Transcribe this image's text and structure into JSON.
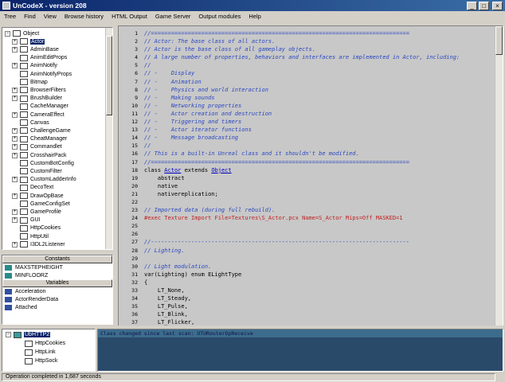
{
  "window": {
    "title": "UnCodeX - version 208",
    "min": "_",
    "max": "□",
    "close": "×"
  },
  "menu": [
    "Tree",
    "Find",
    "View",
    "Browse history",
    "HTML Output",
    "Game Server",
    "Output modules",
    "Help"
  ],
  "tree": {
    "root": "Object",
    "items": [
      {
        "label": "Actor",
        "exp": true,
        "selected": true
      },
      {
        "label": "AdminBase",
        "exp": true
      },
      {
        "label": "AnimEditProps",
        "exp": false
      },
      {
        "label": "AnimNotify",
        "exp": true
      },
      {
        "label": "AnimNotifyProps",
        "exp": false
      },
      {
        "label": "Bitmap",
        "exp": false
      },
      {
        "label": "BrowserFilters",
        "exp": true
      },
      {
        "label": "BrushBuilder",
        "exp": true
      },
      {
        "label": "CacheManager",
        "exp": false
      },
      {
        "label": "CameraEffect",
        "exp": true
      },
      {
        "label": "Canvas",
        "exp": false
      },
      {
        "label": "ChallengeGame",
        "exp": true
      },
      {
        "label": "CheatManager",
        "exp": true
      },
      {
        "label": "Commandlet",
        "exp": true
      },
      {
        "label": "CrosshairPack",
        "exp": true
      },
      {
        "label": "CustomBotConfig",
        "exp": false
      },
      {
        "label": "CustomFilter",
        "exp": false
      },
      {
        "label": "CustomLadderInfo",
        "exp": true
      },
      {
        "label": "DecoText",
        "exp": false
      },
      {
        "label": "DrawOpBase",
        "exp": true
      },
      {
        "label": "GameConfigSet",
        "exp": false
      },
      {
        "label": "GameProfile",
        "exp": true
      },
      {
        "label": "GUI",
        "exp": true
      },
      {
        "label": "HttpCookies",
        "exp": false
      },
      {
        "label": "HttpUtil",
        "exp": false
      },
      {
        "label": "I3DL2Listener",
        "exp": true
      }
    ]
  },
  "panel": {
    "constants_header": "Constants",
    "constants": [
      "MAXSTEPHEIGHT",
      "MINFLOORZ"
    ],
    "variables_header": "Variables",
    "variables": [
      "Acceleration",
      "ActorRenderData",
      "Attached"
    ]
  },
  "editor": {
    "lines": [
      {
        "n": "1",
        "parts": [
          {
            "t": "//=============================================================================",
            "c": "cm"
          }
        ]
      },
      {
        "n": "2",
        "parts": [
          {
            "t": "// Actor: The base class of all actors.",
            "c": "cm"
          }
        ]
      },
      {
        "n": "3",
        "parts": [
          {
            "t": "// Actor is the base class of all gameplay objects.",
            "c": "cm"
          }
        ]
      },
      {
        "n": "4",
        "parts": [
          {
            "t": "// A large number of properties, behaviors and interfaces are implemented in Actor, including:",
            "c": "cm"
          }
        ]
      },
      {
        "n": "5",
        "parts": [
          {
            "t": "//",
            "c": "cm"
          }
        ]
      },
      {
        "n": "6",
        "parts": [
          {
            "t": "// -    Display",
            "c": "cm"
          }
        ]
      },
      {
        "n": "7",
        "parts": [
          {
            "t": "// -    Animation",
            "c": "cm"
          }
        ]
      },
      {
        "n": "8",
        "parts": [
          {
            "t": "// -    Physics and world interaction",
            "c": "cm"
          }
        ]
      },
      {
        "n": "9",
        "parts": [
          {
            "t": "// -    Making sounds",
            "c": "cm"
          }
        ]
      },
      {
        "n": "10",
        "parts": [
          {
            "t": "// -    Networking properties",
            "c": "cm"
          }
        ]
      },
      {
        "n": "11",
        "parts": [
          {
            "t": "// -    Actor creation and destruction",
            "c": "cm"
          }
        ]
      },
      {
        "n": "12",
        "parts": [
          {
            "t": "// -    Triggering and timers",
            "c": "cm"
          }
        ]
      },
      {
        "n": "13",
        "parts": [
          {
            "t": "// -    Actor iterator functions",
            "c": "cm"
          }
        ]
      },
      {
        "n": "14",
        "parts": [
          {
            "t": "// -    Message broadcasting",
            "c": "cm"
          }
        ]
      },
      {
        "n": "15",
        "parts": [
          {
            "t": "//",
            "c": "cm"
          }
        ]
      },
      {
        "n": "16",
        "parts": [
          {
            "t": "// This is a built-in Unreal class and it shouldn't be modified.",
            "c": "cm"
          }
        ]
      },
      {
        "n": "17",
        "parts": [
          {
            "t": "//=============================================================================",
            "c": "cm"
          }
        ]
      },
      {
        "n": "18",
        "parts": [
          {
            "t": "class ",
            "c": ""
          },
          {
            "t": "Actor",
            "c": "lnk"
          },
          {
            "t": " extends ",
            "c": ""
          },
          {
            "t": "Object",
            "c": "lnk"
          }
        ]
      },
      {
        "n": "19",
        "parts": [
          {
            "t": "    abstract",
            "c": ""
          }
        ]
      },
      {
        "n": "20",
        "parts": [
          {
            "t": "    native",
            "c": ""
          }
        ]
      },
      {
        "n": "21",
        "parts": [
          {
            "t": "    nativereplication;",
            "c": ""
          }
        ]
      },
      {
        "n": "22",
        "parts": [
          {
            "t": "",
            "c": ""
          }
        ]
      },
      {
        "n": "23",
        "parts": [
          {
            "t": "// Imported data (during full rebuild).",
            "c": "cm"
          }
        ]
      },
      {
        "n": "24",
        "parts": [
          {
            "t": "#exec Texture Import File=Textures\\S_Actor.pcx Name=S_Actor Mips=Off MASKED=1",
            "c": "ex"
          }
        ]
      },
      {
        "n": "25",
        "parts": [
          {
            "t": "",
            "c": ""
          }
        ]
      },
      {
        "n": "26",
        "parts": [
          {
            "t": "",
            "c": ""
          }
        ]
      },
      {
        "n": "27",
        "parts": [
          {
            "t": "//-----------------------------------------------------------------------------",
            "c": "cm"
          }
        ]
      },
      {
        "n": "28",
        "parts": [
          {
            "t": "// Lighting.",
            "c": "cm"
          }
        ]
      },
      {
        "n": "29",
        "parts": [
          {
            "t": "",
            "c": ""
          }
        ]
      },
      {
        "n": "30",
        "parts": [
          {
            "t": "// Light modulation.",
            "c": "cm"
          }
        ]
      },
      {
        "n": "31",
        "parts": [
          {
            "t": "var(Lighting) enum ELightType",
            "c": ""
          }
        ]
      },
      {
        "n": "32",
        "parts": [
          {
            "t": "{",
            "c": ""
          }
        ]
      },
      {
        "n": "33",
        "parts": [
          {
            "t": "    LT_None,",
            "c": ""
          }
        ]
      },
      {
        "n": "34",
        "parts": [
          {
            "t": "    LT_Steady,",
            "c": ""
          }
        ]
      },
      {
        "n": "35",
        "parts": [
          {
            "t": "    LT_Pulse,",
            "c": ""
          }
        ]
      },
      {
        "n": "36",
        "parts": [
          {
            "t": "    LT_Blink,",
            "c": ""
          }
        ]
      },
      {
        "n": "37",
        "parts": [
          {
            "t": "    LT_Flicker,",
            "c": ""
          }
        ]
      }
    ]
  },
  "btree": {
    "root": "UbHTTP2",
    "items": [
      "HttpCookies",
      "HttpLink",
      "HttpSock"
    ]
  },
  "log": {
    "line": "Class changed since last scan: UTURouterOpReceive"
  },
  "status": {
    "text": "Operation completed in 1,687 seconds"
  }
}
